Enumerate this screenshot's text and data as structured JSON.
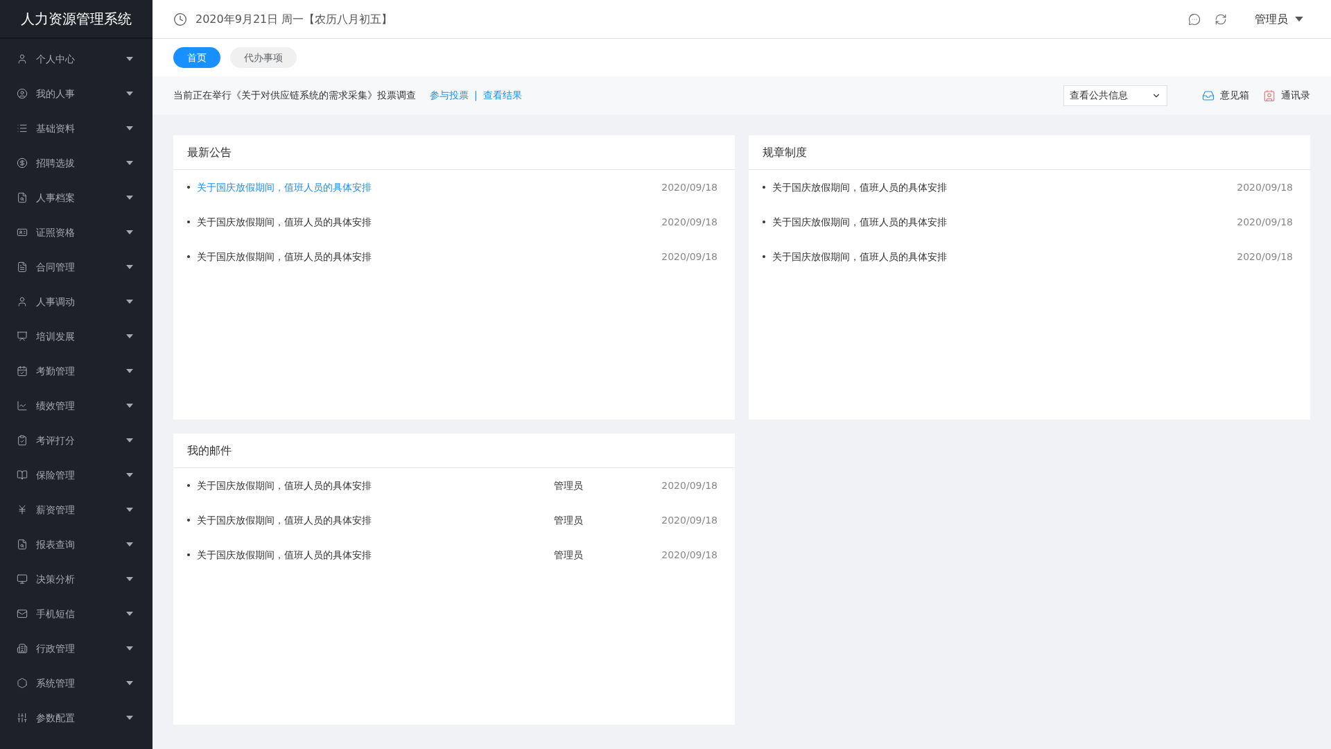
{
  "app_title": "人力资源管理系统",
  "sidebar": {
    "items": [
      {
        "label": "个人中心"
      },
      {
        "label": "我的人事"
      },
      {
        "label": "基础资料"
      },
      {
        "label": "招聘选拔"
      },
      {
        "label": "人事档案"
      },
      {
        "label": "证照资格"
      },
      {
        "label": "合同管理"
      },
      {
        "label": "人事调动"
      },
      {
        "label": "培训发展"
      },
      {
        "label": "考勤管理"
      },
      {
        "label": "绩效管理"
      },
      {
        "label": "考评打分"
      },
      {
        "label": "保险管理"
      },
      {
        "label": "薪资管理"
      },
      {
        "label": "报表查询"
      },
      {
        "label": "决策分析"
      },
      {
        "label": "手机短信"
      },
      {
        "label": "行政管理"
      },
      {
        "label": "系统管理"
      },
      {
        "label": "参数配置"
      }
    ]
  },
  "header": {
    "date": "2020年9月21日 周一【农历八月初五】",
    "user": "管理员"
  },
  "tabs": [
    {
      "label": "首页",
      "selected": true
    },
    {
      "label": "代办事项",
      "selected": false
    }
  ],
  "notice": {
    "text": "当前正在举行《关于对供应链系统的需求采集》投票调查",
    "links": [
      "参与投票",
      "查看结果"
    ],
    "separator": "|",
    "select": {
      "value": "查看公共信息"
    },
    "actions": [
      {
        "label": "意见箱"
      },
      {
        "label": "通讯录"
      }
    ]
  },
  "announcements": {
    "title": "最新公告",
    "items": [
      {
        "title": "关于国庆放假期间，值班人员的具体安排",
        "date": "2020/09/18",
        "highlighted": true
      },
      {
        "title": "关于国庆放假期间，值班人员的具体安排",
        "date": "2020/09/18",
        "highlighted": false
      },
      {
        "title": "关于国庆放假期间，值班人员的具体安排",
        "date": "2020/09/18",
        "highlighted": false
      }
    ]
  },
  "regulations": {
    "title": "规章制度",
    "items": [
      {
        "title": "关于国庆放假期间，值班人员的具体安排",
        "date": "2020/09/18"
      },
      {
        "title": "关于国庆放假期间，值班人员的具体安排",
        "date": "2020/09/18"
      },
      {
        "title": "关于国庆放假期间，值班人员的具体安排",
        "date": "2020/09/18"
      }
    ]
  },
  "mail": {
    "title": "我的邮件",
    "items": [
      {
        "title": "关于国庆放假期间，值班人员的具体安排",
        "sender": "管理员",
        "date": "2020/09/18"
      },
      {
        "title": "关于国庆放假期间，值班人员的具体安排",
        "sender": "管理员",
        "date": "2020/09/18"
      },
      {
        "title": "关于国庆放假期间，值班人员的具体安排",
        "sender": "管理员",
        "date": "2020/09/18"
      }
    ]
  }
}
